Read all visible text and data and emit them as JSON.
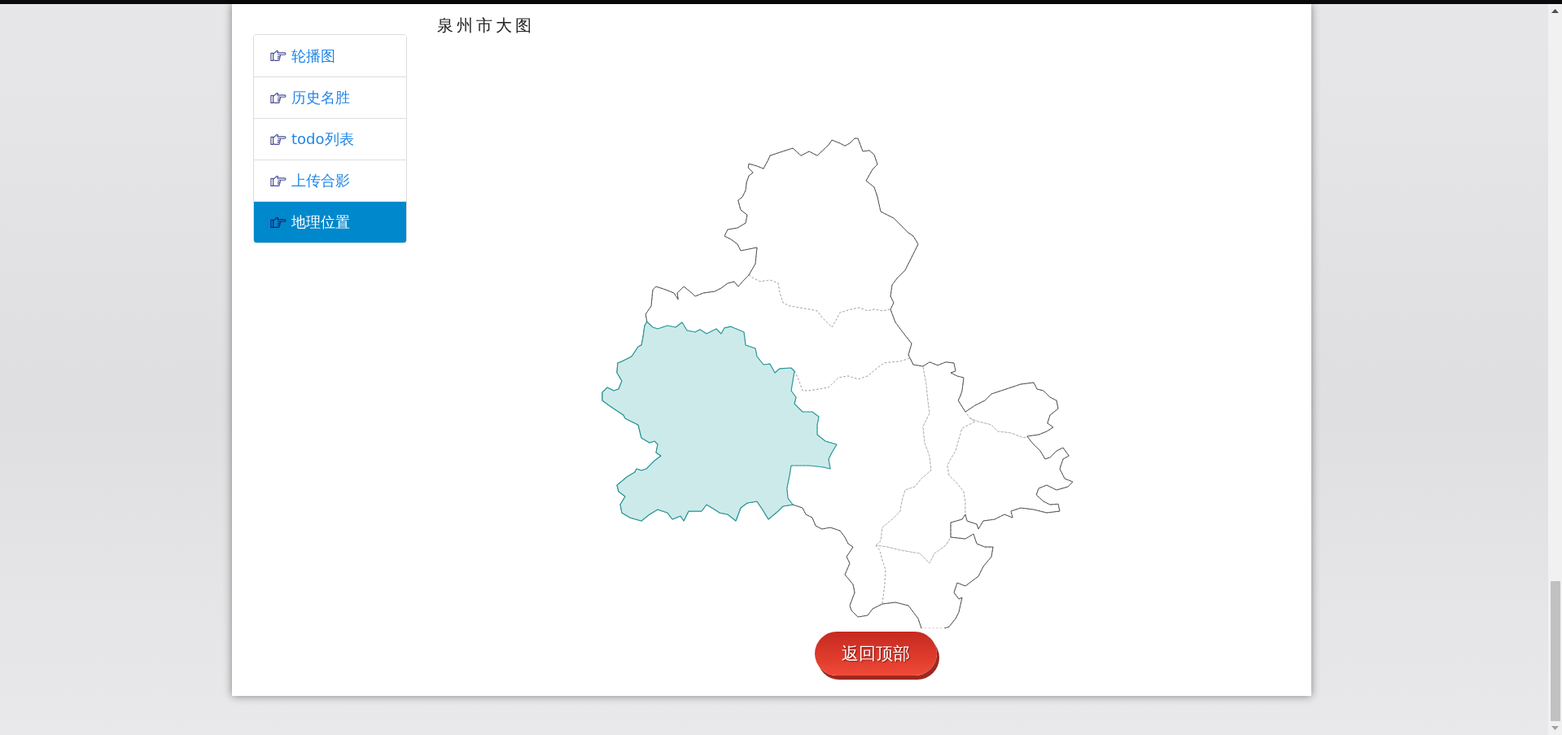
{
  "title": "泉州市大图",
  "sidebar": {
    "items": [
      {
        "label": "轮播图",
        "selected": false
      },
      {
        "label": "历史名胜",
        "selected": false
      },
      {
        "label": "todo列表",
        "selected": false
      },
      {
        "label": "上传合影",
        "selected": false
      },
      {
        "label": "地理位置",
        "selected": true
      }
    ]
  },
  "map": {
    "regions": [
      {
        "selected": false
      },
      {
        "selected": false
      },
      {
        "selected": true
      },
      {
        "selected": false
      },
      {
        "selected": false
      },
      {
        "selected": false
      },
      {
        "selected": false
      },
      {
        "selected": false
      }
    ]
  },
  "back_to_top_button": "返回顶部"
}
